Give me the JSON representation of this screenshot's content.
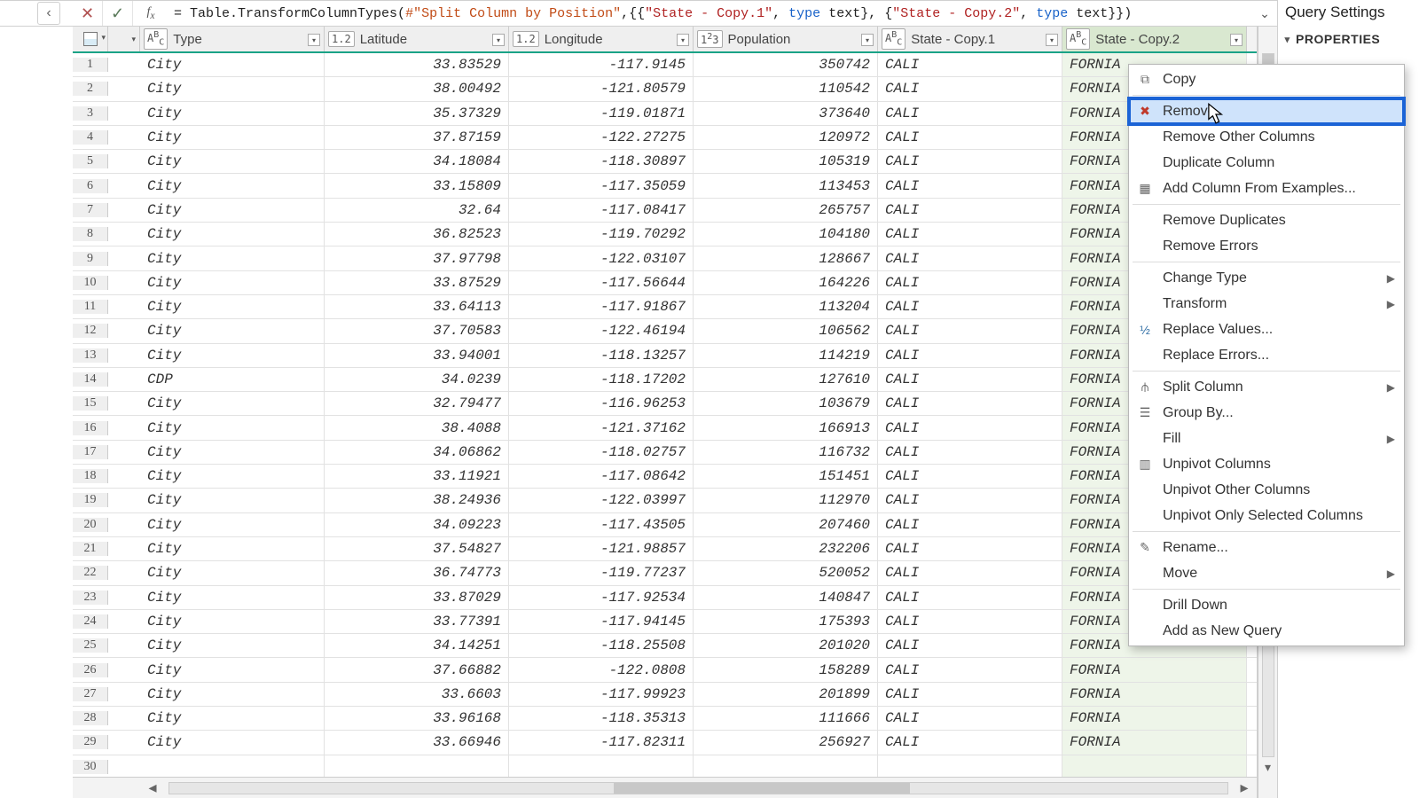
{
  "formula": {
    "text": "= Table.TransformColumnTypes(#\"Split Column by Position\",{{\"State - Copy.1\", type text}, {\"State - Copy.2\", type text}})"
  },
  "settings": {
    "title": "Query Settings",
    "section1": "PROPERTIES"
  },
  "columns": {
    "type": {
      "label": "Type",
      "type_icon": "ABC"
    },
    "lat": {
      "label": "Latitude",
      "type_icon": "1.2"
    },
    "lon": {
      "label": "Longitude",
      "type_icon": "1.2"
    },
    "pop": {
      "label": "Population",
      "type_icon": "1²3"
    },
    "sc1": {
      "label": "State - Copy.1",
      "type_icon": "ABC"
    },
    "sc2": {
      "label": "State - Copy.2",
      "type_icon": "ABC"
    }
  },
  "rows": [
    {
      "n": 1,
      "type": "City",
      "lat": "33.83529",
      "lon": "-117.9145",
      "pop": "350742",
      "sc1": "CALI",
      "sc2": "FORNIA"
    },
    {
      "n": 2,
      "type": "City",
      "lat": "38.00492",
      "lon": "-121.80579",
      "pop": "110542",
      "sc1": "CALI",
      "sc2": "FORNIA"
    },
    {
      "n": 3,
      "type": "City",
      "lat": "35.37329",
      "lon": "-119.01871",
      "pop": "373640",
      "sc1": "CALI",
      "sc2": "FORNIA"
    },
    {
      "n": 4,
      "type": "City",
      "lat": "37.87159",
      "lon": "-122.27275",
      "pop": "120972",
      "sc1": "CALI",
      "sc2": "FORNIA"
    },
    {
      "n": 5,
      "type": "City",
      "lat": "34.18084",
      "lon": "-118.30897",
      "pop": "105319",
      "sc1": "CALI",
      "sc2": "FORNIA"
    },
    {
      "n": 6,
      "type": "City",
      "lat": "33.15809",
      "lon": "-117.35059",
      "pop": "113453",
      "sc1": "CALI",
      "sc2": "FORNIA"
    },
    {
      "n": 7,
      "type": "City",
      "lat": "32.64",
      "lon": "-117.08417",
      "pop": "265757",
      "sc1": "CALI",
      "sc2": "FORNIA"
    },
    {
      "n": 8,
      "type": "City",
      "lat": "36.82523",
      "lon": "-119.70292",
      "pop": "104180",
      "sc1": "CALI",
      "sc2": "FORNIA"
    },
    {
      "n": 9,
      "type": "City",
      "lat": "37.97798",
      "lon": "-122.03107",
      "pop": "128667",
      "sc1": "CALI",
      "sc2": "FORNIA"
    },
    {
      "n": 10,
      "type": "City",
      "lat": "33.87529",
      "lon": "-117.56644",
      "pop": "164226",
      "sc1": "CALI",
      "sc2": "FORNIA"
    },
    {
      "n": 11,
      "type": "City",
      "lat": "33.64113",
      "lon": "-117.91867",
      "pop": "113204",
      "sc1": "CALI",
      "sc2": "FORNIA"
    },
    {
      "n": 12,
      "type": "City",
      "lat": "37.70583",
      "lon": "-122.46194",
      "pop": "106562",
      "sc1": "CALI",
      "sc2": "FORNIA"
    },
    {
      "n": 13,
      "type": "City",
      "lat": "33.94001",
      "lon": "-118.13257",
      "pop": "114219",
      "sc1": "CALI",
      "sc2": "FORNIA"
    },
    {
      "n": 14,
      "type": "CDP",
      "lat": "34.0239",
      "lon": "-118.17202",
      "pop": "127610",
      "sc1": "CALI",
      "sc2": "FORNIA"
    },
    {
      "n": 15,
      "type": "City",
      "lat": "32.79477",
      "lon": "-116.96253",
      "pop": "103679",
      "sc1": "CALI",
      "sc2": "FORNIA"
    },
    {
      "n": 16,
      "type": "City",
      "lat": "38.4088",
      "lon": "-121.37162",
      "pop": "166913",
      "sc1": "CALI",
      "sc2": "FORNIA"
    },
    {
      "n": 17,
      "type": "City",
      "lat": "34.06862",
      "lon": "-118.02757",
      "pop": "116732",
      "sc1": "CALI",
      "sc2": "FORNIA"
    },
    {
      "n": 18,
      "type": "City",
      "lat": "33.11921",
      "lon": "-117.08642",
      "pop": "151451",
      "sc1": "CALI",
      "sc2": "FORNIA"
    },
    {
      "n": 19,
      "type": "City",
      "lat": "38.24936",
      "lon": "-122.03997",
      "pop": "112970",
      "sc1": "CALI",
      "sc2": "FORNIA"
    },
    {
      "n": 20,
      "type": "City",
      "lat": "34.09223",
      "lon": "-117.43505",
      "pop": "207460",
      "sc1": "CALI",
      "sc2": "FORNIA"
    },
    {
      "n": 21,
      "type": "City",
      "lat": "37.54827",
      "lon": "-121.98857",
      "pop": "232206",
      "sc1": "CALI",
      "sc2": "FORNIA"
    },
    {
      "n": 22,
      "type": "City",
      "lat": "36.74773",
      "lon": "-119.77237",
      "pop": "520052",
      "sc1": "CALI",
      "sc2": "FORNIA"
    },
    {
      "n": 23,
      "type": "City",
      "lat": "33.87029",
      "lon": "-117.92534",
      "pop": "140847",
      "sc1": "CALI",
      "sc2": "FORNIA"
    },
    {
      "n": 24,
      "type": "City",
      "lat": "33.77391",
      "lon": "-117.94145",
      "pop": "175393",
      "sc1": "CALI",
      "sc2": "FORNIA"
    },
    {
      "n": 25,
      "type": "City",
      "lat": "34.14251",
      "lon": "-118.25508",
      "pop": "201020",
      "sc1": "CALI",
      "sc2": "FORNIA"
    },
    {
      "n": 26,
      "type": "City",
      "lat": "37.66882",
      "lon": "-122.0808",
      "pop": "158289",
      "sc1": "CALI",
      "sc2": "FORNIA"
    },
    {
      "n": 27,
      "type": "City",
      "lat": "33.6603",
      "lon": "-117.99923",
      "pop": "201899",
      "sc1": "CALI",
      "sc2": "FORNIA"
    },
    {
      "n": 28,
      "type": "City",
      "lat": "33.96168",
      "lon": "-118.35313",
      "pop": "111666",
      "sc1": "CALI",
      "sc2": "FORNIA"
    },
    {
      "n": 29,
      "type": "City",
      "lat": "33.66946",
      "lon": "-117.82311",
      "pop": "256927",
      "sc1": "CALI",
      "sc2": "FORNIA"
    },
    {
      "n": 30,
      "type": "",
      "lat": "",
      "lon": "",
      "pop": "",
      "sc1": "",
      "sc2": ""
    }
  ],
  "menu": {
    "copy": "Copy",
    "remove": "Remove",
    "remove_other": "Remove Other Columns",
    "duplicate": "Duplicate Column",
    "add_from_examples": "Add Column From Examples...",
    "remove_dups": "Remove Duplicates",
    "remove_errors": "Remove Errors",
    "change_type": "Change Type",
    "transform": "Transform",
    "replace_values": "Replace Values...",
    "replace_errors": "Replace Errors...",
    "split_column": "Split Column",
    "group_by": "Group By...",
    "fill": "Fill",
    "unpivot": "Unpivot Columns",
    "unpivot_other": "Unpivot Other Columns",
    "unpivot_sel": "Unpivot Only Selected Columns",
    "rename": "Rename...",
    "move": "Move",
    "drill_down": "Drill Down",
    "add_new_query": "Add as New Query"
  }
}
